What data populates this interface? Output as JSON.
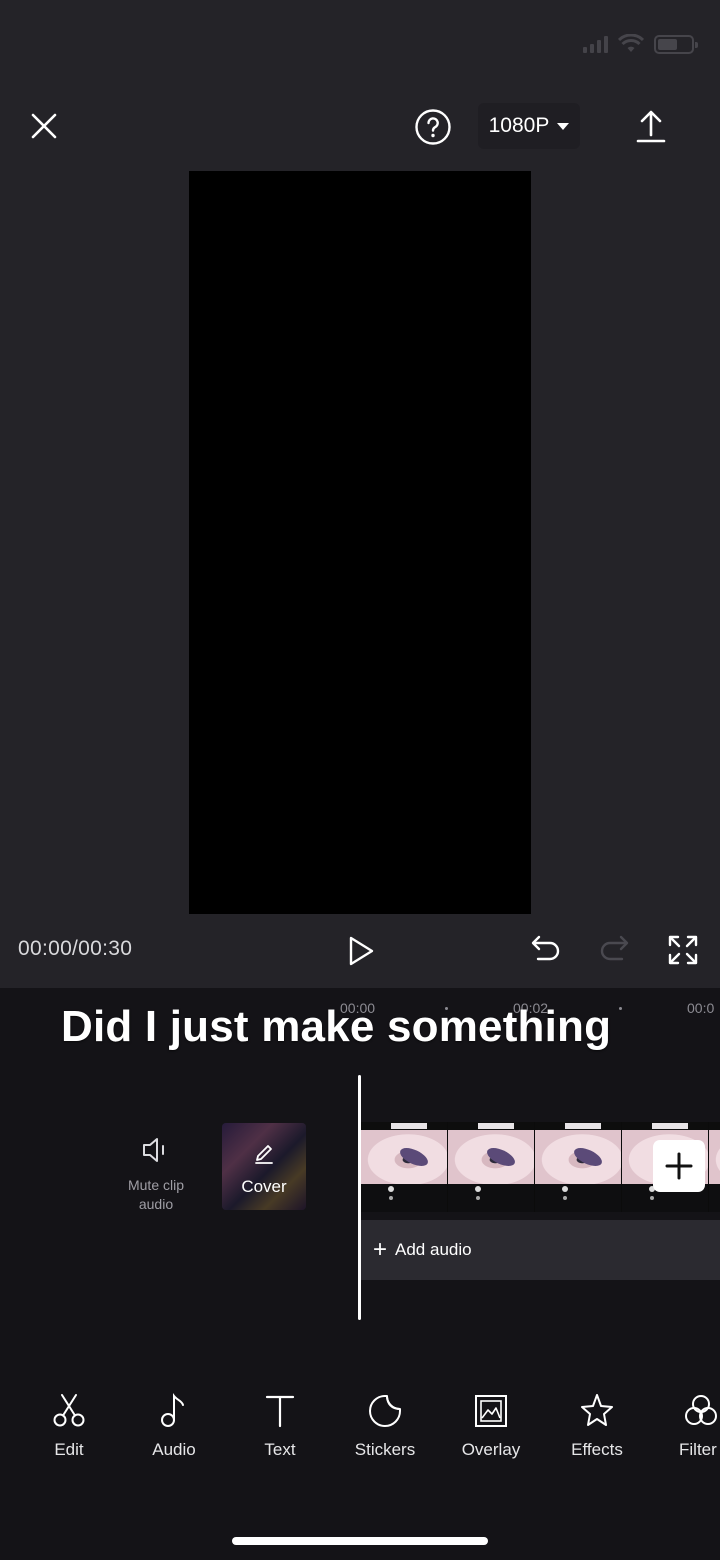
{
  "header": {
    "resolution_label": "1080P"
  },
  "player": {
    "timecode": "00:00/00:30"
  },
  "timeline": {
    "ruler_ticks": [
      "00:00",
      "00:02",
      "00:0"
    ],
    "overlay_caption": "Did I just make something",
    "mute_label_line1": "Mute clip",
    "mute_label_line2": "audio",
    "cover_label": "Cover",
    "add_audio_label": "Add audio"
  },
  "toolbar": {
    "items": [
      {
        "label": "Edit",
        "icon": "scissors-icon"
      },
      {
        "label": "Audio",
        "icon": "music-note-icon"
      },
      {
        "label": "Text",
        "icon": "text-icon"
      },
      {
        "label": "Stickers",
        "icon": "sticker-icon"
      },
      {
        "label": "Overlay",
        "icon": "overlay-icon"
      },
      {
        "label": "Effects",
        "icon": "effects-star-icon"
      },
      {
        "label": "Filter",
        "icon": "filter-icon"
      }
    ]
  },
  "colors": {
    "background": "#1b1a20",
    "preview_area": "#242328",
    "timeline_bg": "#141317",
    "audio_track": "#2b2a30"
  }
}
